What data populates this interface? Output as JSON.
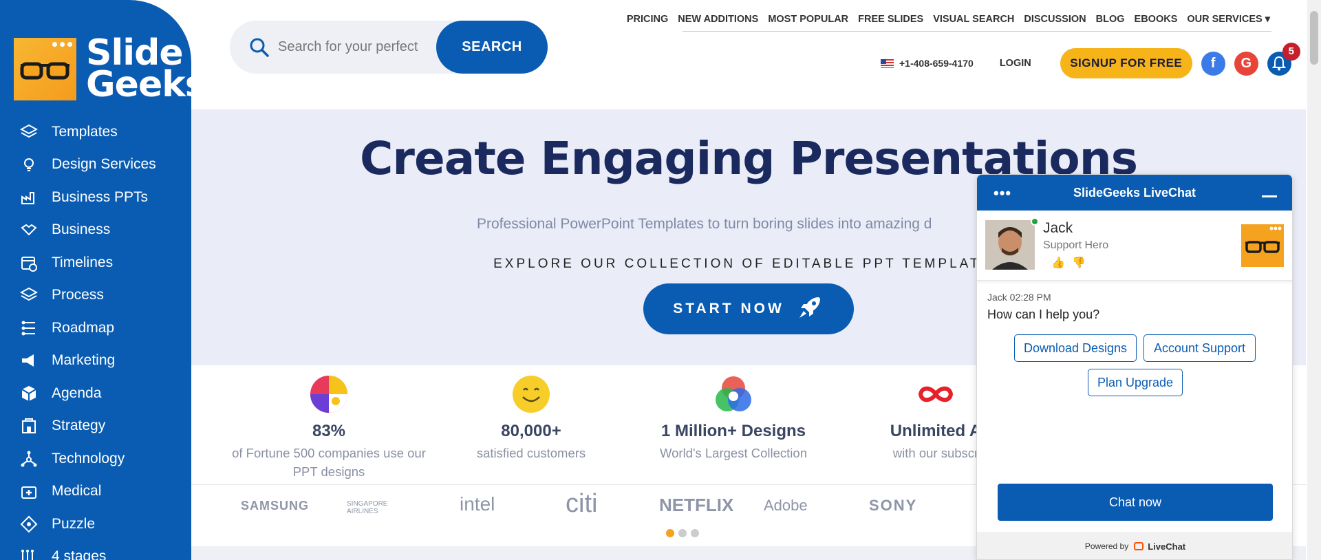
{
  "brand": {
    "line1": "Slide",
    "line2": "Geeks"
  },
  "search": {
    "placeholder": "Search for your perfect",
    "button": "SEARCH"
  },
  "topnav": [
    "PRICING",
    "NEW ADDITIONS",
    "MOST POPULAR",
    "FREE SLIDES",
    "VISUAL SEARCH",
    "DISCUSSION",
    "BLOG",
    "EBOOKS",
    "OUR SERVICES ▾"
  ],
  "contact": {
    "phone": "+1-408-659-4170",
    "login": "LOGIN",
    "signup": "SIGNUP FOR FREE",
    "notifications": "5"
  },
  "sidebar": {
    "items": [
      {
        "label": "Templates",
        "icon": "layers-icon"
      },
      {
        "label": "Design Services",
        "icon": "lightbulb-icon"
      },
      {
        "label": "Business PPTs",
        "icon": "factory-icon"
      },
      {
        "label": "Business",
        "icon": "handshake-icon"
      },
      {
        "label": "Timelines",
        "icon": "calendar-icon"
      },
      {
        "label": "Process",
        "icon": "layers-icon"
      },
      {
        "label": "Roadmap",
        "icon": "roadmap-icon"
      },
      {
        "label": "Marketing",
        "icon": "megaphone-icon"
      },
      {
        "label": "Agenda",
        "icon": "cube-icon"
      },
      {
        "label": "Strategy",
        "icon": "building-icon"
      },
      {
        "label": "Technology",
        "icon": "network-icon"
      },
      {
        "label": "Medical",
        "icon": "medkit-icon"
      },
      {
        "label": "Puzzle",
        "icon": "puzzle-icon"
      },
      {
        "label": "4 stages",
        "icon": "stages-icon"
      }
    ]
  },
  "hero": {
    "title": "Create Engaging Presentations",
    "subtitle": "Professional PowerPoint Templates to turn boring slides into amazing d",
    "explore": "EXPLORE OUR COLLECTION OF EDITABLE PPT TEMPLATES",
    "cta": "START NOW"
  },
  "stats": [
    {
      "big": "83%",
      "small": "of Fortune 500 companies use our PPT designs"
    },
    {
      "big": "80,000+",
      "small": "satisfied customers"
    },
    {
      "big": "1 Million+ Designs",
      "small": "World's Largest Collection"
    },
    {
      "big": "Unlimited A",
      "small": "with our subscr"
    }
  ],
  "brands": [
    "SAMSUNG",
    "SINGAPORE AIRLINES",
    "intel",
    "citi",
    "NETFLIX",
    "Adobe",
    "SONY"
  ],
  "chat": {
    "title": "SlideGeeks LiveChat",
    "agent_name": "Jack",
    "agent_role": "Support Hero",
    "meta": "Jack 02:28 PM",
    "message": "How can I help you?",
    "quick_replies": [
      "Download Designs",
      "Account Support",
      "Plan Upgrade"
    ],
    "chat_now": "Chat now",
    "powered": "Powered by",
    "powered_brand": "LiveChat"
  },
  "colors": {
    "primary": "#0a5cb2",
    "accent": "#f6b419",
    "hero_bg": "#eaedf7",
    "title": "#1b2a5e"
  }
}
